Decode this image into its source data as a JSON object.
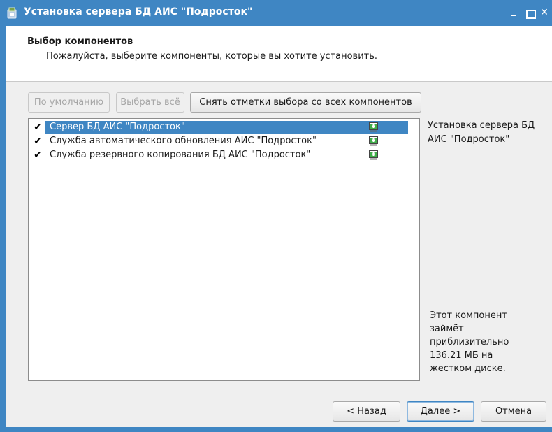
{
  "window": {
    "title": "Установка сервера БД АИС \"Подросток\"",
    "accent_color": "#3f86c3"
  },
  "header": {
    "title": "Выбор компонентов",
    "subtitle": "Пожалуйста, выберите компоненты, которые вы хотите установить."
  },
  "toolbar": {
    "default_label": "По умолчанию",
    "select_all_label": "Выбрать всё",
    "clear_first_letter": "С",
    "clear_rest": "нять отметки выбора со всех компонентов"
  },
  "components": [
    {
      "label": "Сервер БД АИС \"Подросток\"",
      "checked": true,
      "selected": true,
      "icon": "install-icon"
    },
    {
      "label": "Служба автоматического обновления АИС \"Подросток\"",
      "checked": true,
      "selected": false,
      "icon": "install-icon"
    },
    {
      "label": "Служба резервного копирования БД АИС \"Подросток\"",
      "checked": true,
      "selected": false,
      "icon": "install-icon"
    }
  ],
  "description": "Установка сервера БД АИС \"Подросток\"",
  "space_info": {
    "line1": "Этот компонент",
    "line2": "займёт",
    "line3": "приблизительно",
    "line4": "136.21 МБ на",
    "line5": "жестком диске."
  },
  "footer": {
    "back_prefix": "< ",
    "back_hotkey": "Н",
    "back_rest": "азад",
    "next_hotkey": "Д",
    "next_rest": "алее >",
    "cancel_label": "Отмена"
  },
  "check_glyph": "✔"
}
